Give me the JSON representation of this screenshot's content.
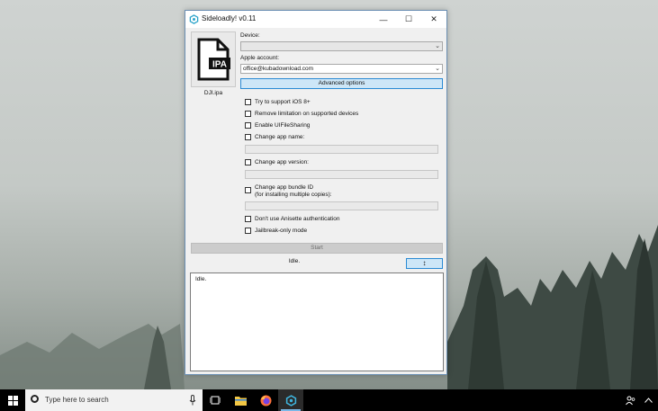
{
  "window": {
    "title": "Sideloadly! v0.11",
    "controls": {
      "minimize": "—",
      "maximize": "☐",
      "close": "✕"
    }
  },
  "ipa": {
    "file_name": "DJI.ipa",
    "badge": "IPA"
  },
  "device": {
    "label": "Device:",
    "value": ""
  },
  "apple_account": {
    "label": "Apple account:",
    "value": "office@kubadownload.com"
  },
  "advanced_button": "Advanced options",
  "options": [
    {
      "label": "Try to support iOS 8+",
      "checked": false
    },
    {
      "label": "Remove limitation on supported devices",
      "checked": false
    },
    {
      "label": "Enable UIFileSharing",
      "checked": false
    },
    {
      "label": "Change app name:",
      "checked": false
    },
    {
      "label": "Change app version:",
      "checked": false
    },
    {
      "label": "Change app bundle ID",
      "label_line2": "(for installing multiple copies):",
      "checked": false
    },
    {
      "label": "Don't use Anisette authentication",
      "checked": false
    },
    {
      "label": "Jailbreak-only mode",
      "checked": false
    }
  ],
  "start_button": "Start",
  "status_text": "Idle.",
  "toggle_log_button": "↕",
  "log_text": "Idle.",
  "taskbar": {
    "search_placeholder": "Type here to search"
  }
}
